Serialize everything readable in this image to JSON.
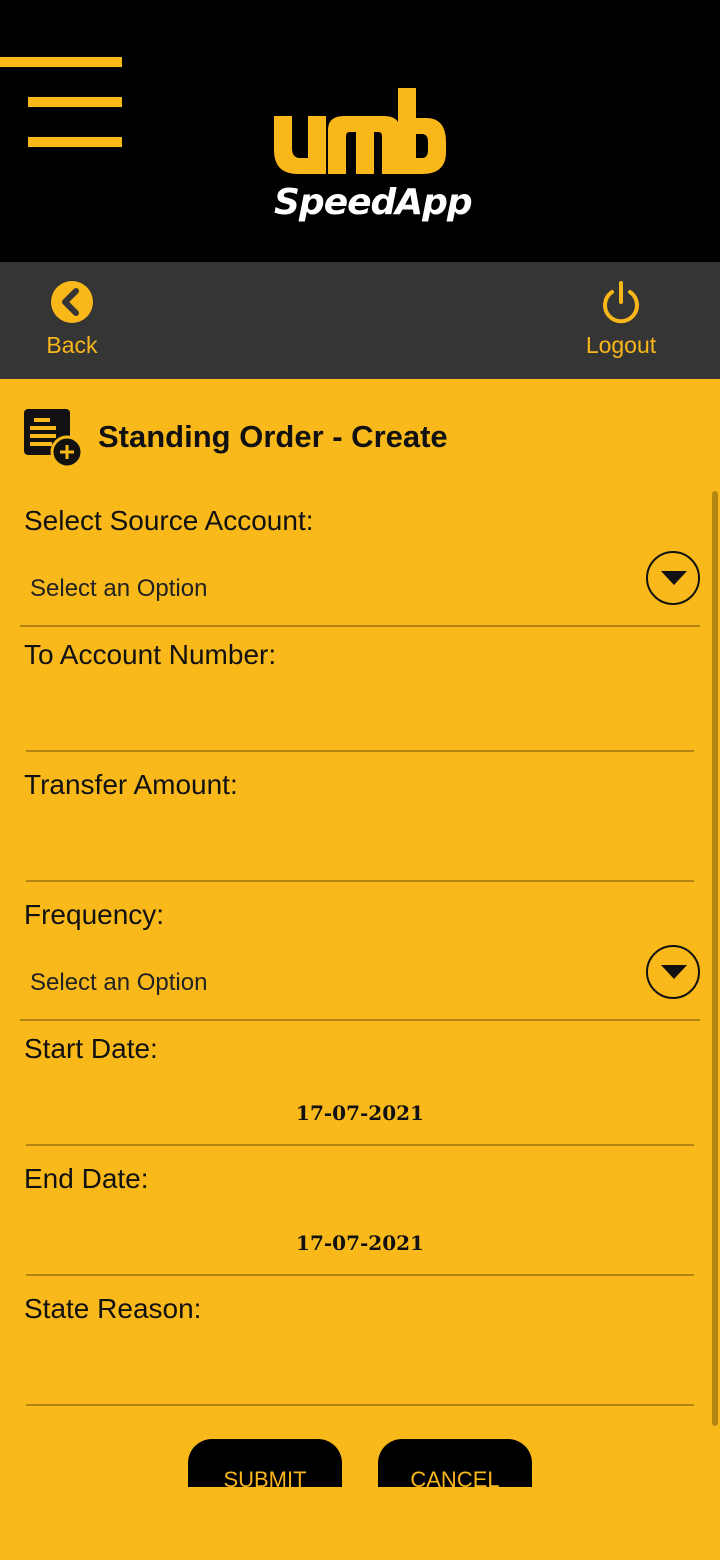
{
  "header": {
    "logo_text": "umb",
    "logo_subtitle": "SpeedApp",
    "menu_icon": "hamburger-menu-icon"
  },
  "nav": {
    "back_label": "Back",
    "back_icon": "chevron-left-circle-icon",
    "logout_label": "Logout",
    "logout_icon": "power-icon"
  },
  "page": {
    "title": "Standing Order - Create",
    "title_icon": "document-add-icon"
  },
  "form": {
    "source_account": {
      "label": "Select Source Account:",
      "value": "Select an Option"
    },
    "to_account": {
      "label": "To Account Number:",
      "value": ""
    },
    "amount": {
      "label": "Transfer Amount:",
      "value": ""
    },
    "frequency": {
      "label": "Frequency:",
      "value": "Select an Option"
    },
    "start_date": {
      "label": "Start Date:",
      "value": "17-07-2021"
    },
    "end_date": {
      "label": "End Date:",
      "value": "17-07-2021"
    },
    "reason": {
      "label": "State Reason:",
      "value": ""
    }
  },
  "actions": {
    "submit_label": "SUBMIT",
    "cancel_label": "CANCEL"
  },
  "colors": {
    "accent": "#f9b91a",
    "header_bg": "#000000",
    "nav_bg": "#353535"
  }
}
